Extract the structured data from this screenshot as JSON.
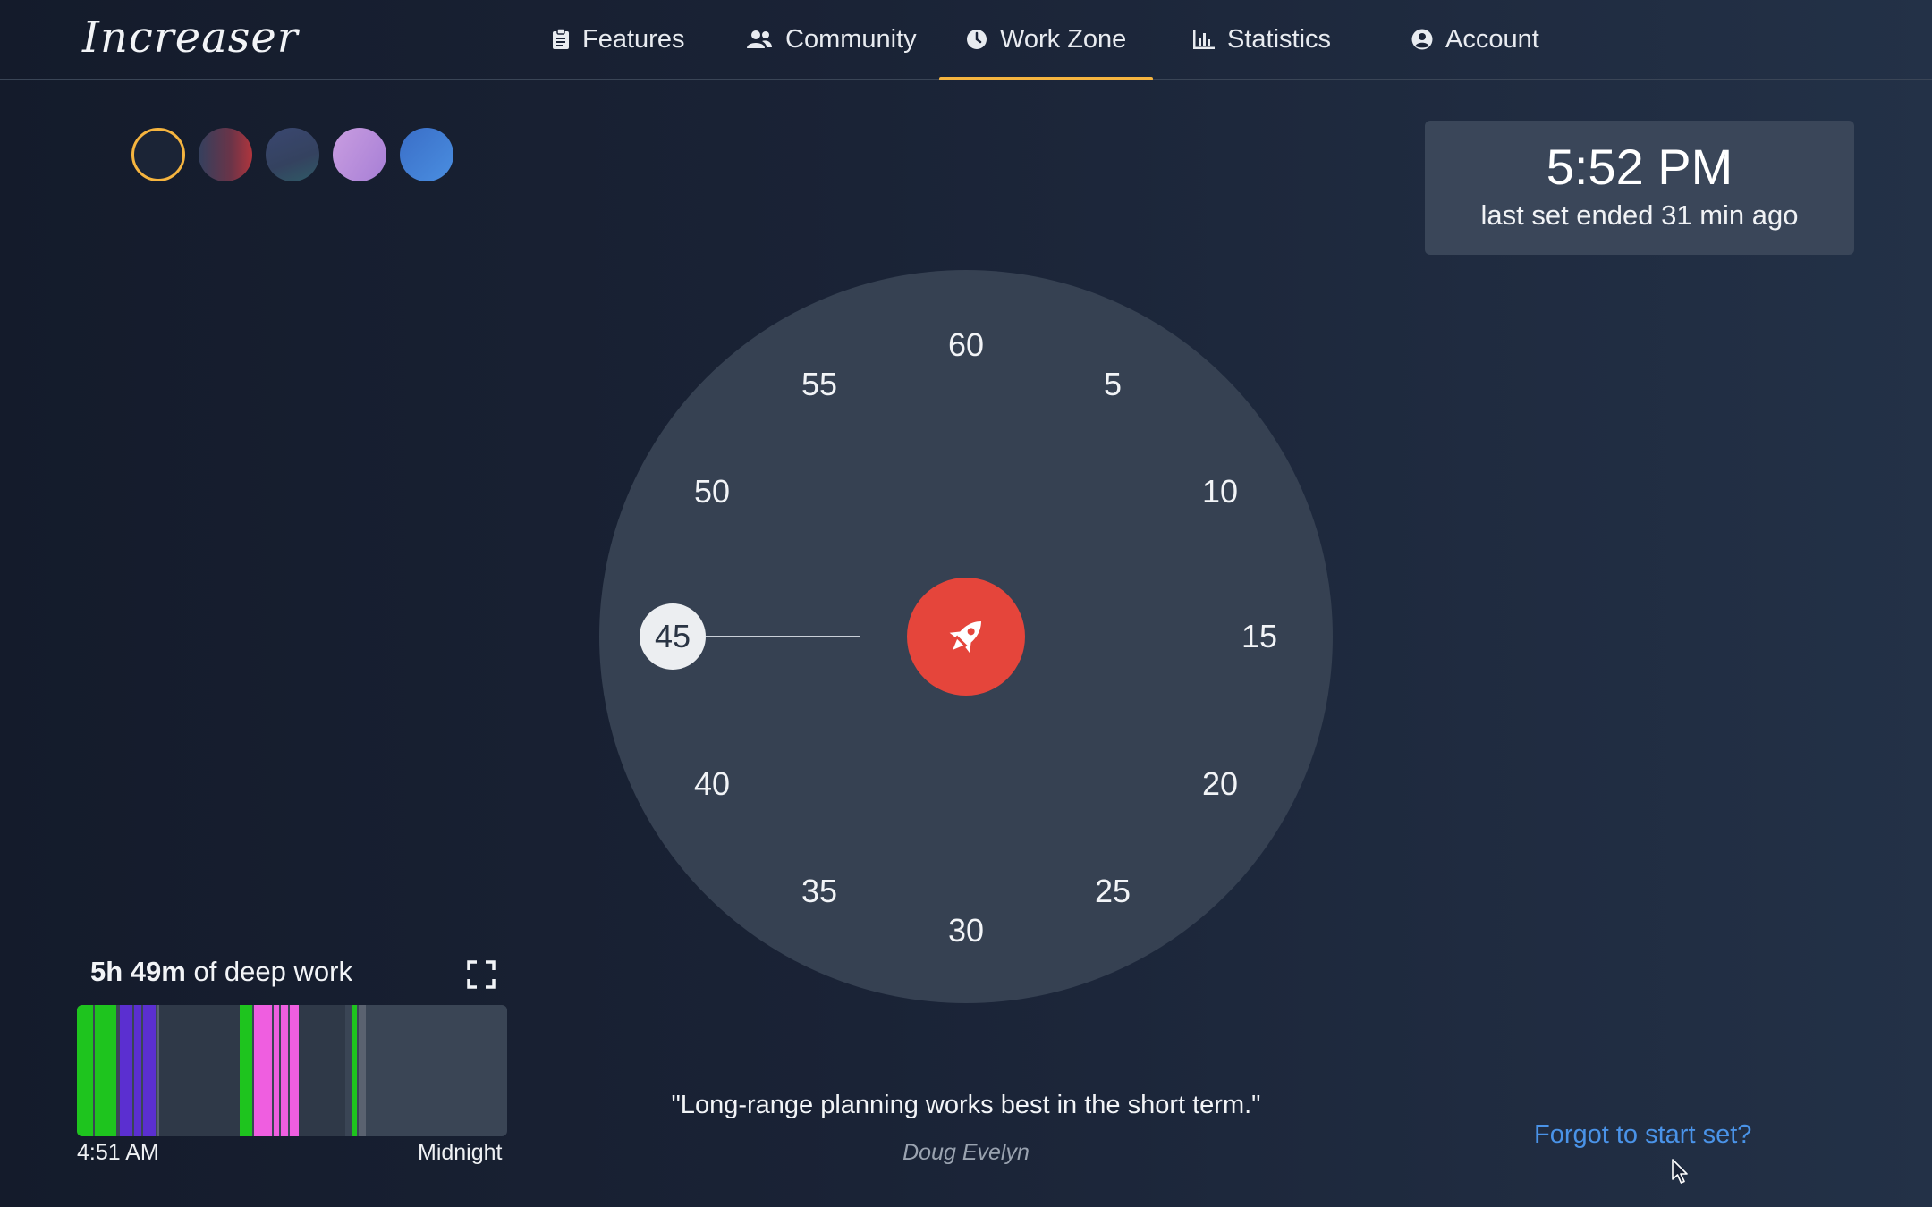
{
  "app": {
    "logo": "Increaser"
  },
  "nav": {
    "items": [
      {
        "label": "Features",
        "icon": "clipboard-icon"
      },
      {
        "label": "Community",
        "icon": "users-icon"
      },
      {
        "label": "Work Zone",
        "icon": "clock-icon",
        "active": true
      },
      {
        "label": "Statistics",
        "icon": "bar-chart-icon"
      },
      {
        "label": "Account",
        "icon": "user-circle-icon"
      }
    ],
    "accent_color": "#f5b43f"
  },
  "themes": [
    {
      "name": "dark-navy",
      "color": "#1c2436",
      "selected": true
    },
    {
      "name": "navy-red",
      "color": "#8a3a4a"
    },
    {
      "name": "slate-teal",
      "color": "#3b4a6b"
    },
    {
      "name": "lavender",
      "color": "#b18ad6"
    },
    {
      "name": "blue",
      "color": "#3f7fd4"
    }
  ],
  "clock": {
    "time": "5:52 PM",
    "subtitle": "last set ended 31 min ago"
  },
  "dial": {
    "ticks": [
      "60",
      "5",
      "10",
      "15",
      "20",
      "25",
      "30",
      "35",
      "40",
      "45",
      "50",
      "55"
    ],
    "selected": "45",
    "start_button_color": "#e5453b",
    "start_icon": "rocket-icon"
  },
  "deep_work": {
    "amount": "5h 49m",
    "label": "of deep work",
    "start_label": "4:51 AM",
    "end_label": "Midnight",
    "timeline_colors": {
      "green": "#1ec41e",
      "purple": "#5b2fd0",
      "pink": "#ef5ee0",
      "gray": "#5a6270",
      "empty": "#2f3948"
    }
  },
  "quote": {
    "text": "\"Long-range planning works best in the short term.\"",
    "author": "Doug Evelyn"
  },
  "forgot_link": "Forgot to start set?"
}
